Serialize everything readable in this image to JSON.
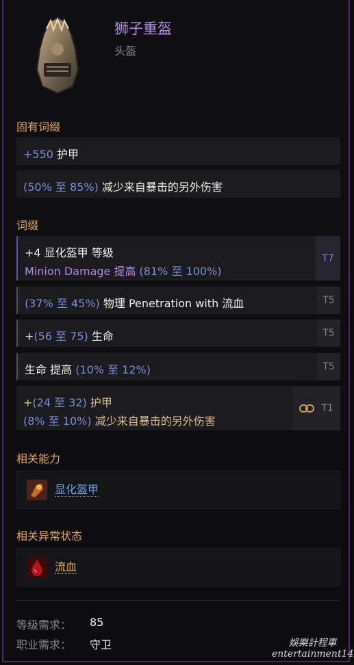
{
  "item": {
    "name": "狮子重盔",
    "type": "头盔",
    "icon": "lion-helmet-icon"
  },
  "implicit": {
    "title": "固有词缀",
    "rows": [
      {
        "value": "+550",
        "text": " 护甲"
      },
      {
        "range_open": "(50% 至 85%)",
        "text": " 减少来自暴击的另外伤害"
      }
    ]
  },
  "affixes": {
    "title": "词缀",
    "t7": {
      "line1": "+4 显化盔甲 等级",
      "line2a": "Minion Damage 提高 ",
      "line2b": "(81% 至 100%)",
      "tier": "T7"
    },
    "t5a": {
      "range": "(37% 至 45%)",
      "text": " 物理 Penetration with 流血",
      "tier": "T5"
    },
    "t5b": {
      "prefix": "+",
      "range": "(56 至 75)",
      "text": " 生命",
      "tier": "T5"
    },
    "t5c": {
      "text": "生命 提高 ",
      "range": "(10% 至 12%)",
      "tier": "T5"
    },
    "t1": {
      "line1a": "+",
      "line1b": "(24 至 32)",
      "line1c": " 护甲",
      "line2a": "(8% 至 10%)",
      "line2b": " 减少来自暴击的另外伤害",
      "tier": "T1",
      "icon": "link-icon"
    }
  },
  "related_ability": {
    "title": "相关能力",
    "name": "显化盔甲",
    "icon": "manifest-armor-icon"
  },
  "related_ailment": {
    "title": "相关异常状态",
    "name": "流血",
    "icon": "bleed-icon"
  },
  "requirements": [
    {
      "label": "等级需求：",
      "value": "85"
    },
    {
      "label": "职业需求：",
      "value": "守卫"
    }
  ],
  "watermark": {
    "line1": "娛樂計程車",
    "line2": "entertainment14"
  },
  "colors": {
    "name": "#b58de0",
    "section": "#e1a85d",
    "range": "#7c8fd2",
    "link": "#6ea3e8",
    "ailment": "#e1a85d"
  }
}
